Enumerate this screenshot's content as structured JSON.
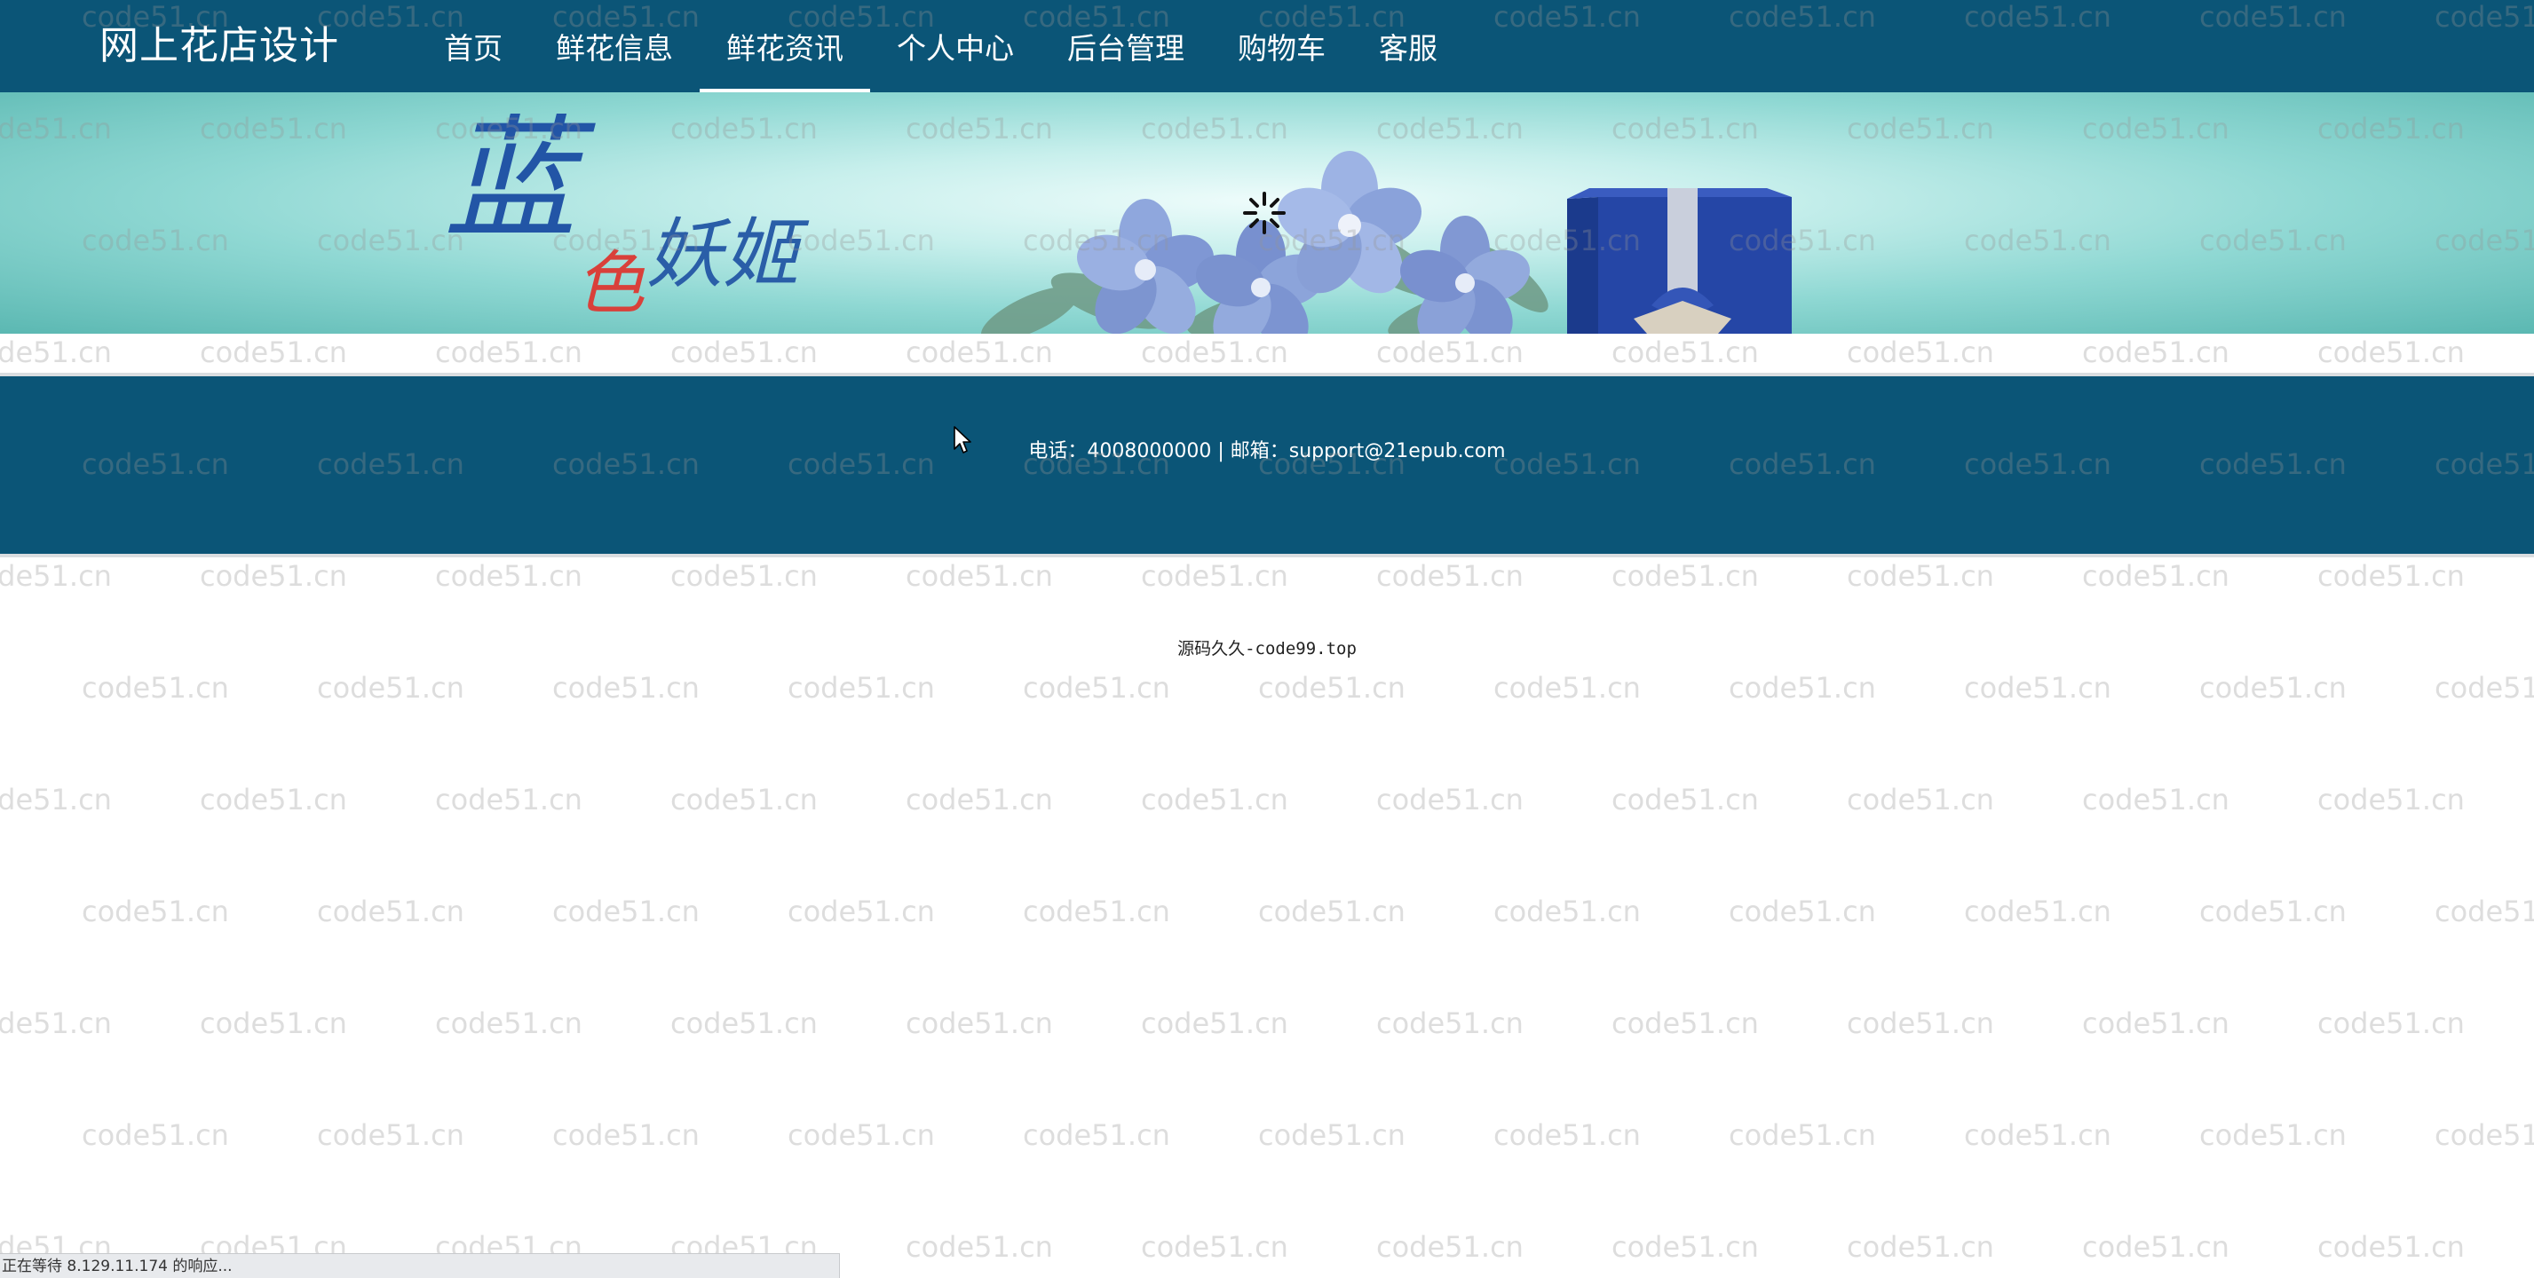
{
  "site": {
    "title": "网上花店设计"
  },
  "nav": {
    "items": [
      {
        "label": "首页",
        "active": false
      },
      {
        "label": "鲜花信息",
        "active": false
      },
      {
        "label": "鲜花资讯",
        "active": true
      },
      {
        "label": "个人中心",
        "active": false
      },
      {
        "label": "后台管理",
        "active": false
      },
      {
        "label": "购物车",
        "active": false
      },
      {
        "label": "客服",
        "active": false
      }
    ]
  },
  "banner": {
    "logo_char_1": "蓝",
    "logo_char_2": "色",
    "logo_chars_3": "妖姬"
  },
  "footer": {
    "contact": "电话：4008000000 | 邮箱：support@21epub.com"
  },
  "credit": {
    "text": "源码久久-code99.top"
  },
  "watermark": {
    "text": "code51.cn"
  },
  "statusbar": {
    "text": "正在等待 8.129.11.174 的响应..."
  },
  "colors": {
    "nav_bg": "#0b5577",
    "footer_bg": "#0b5577",
    "banner_teal": "#8fd8d3",
    "logo_blue": "#2255a6",
    "logo_red": "#d9403a"
  },
  "icons": {
    "loading": "loading-spinner-icon",
    "cursor": "mouse-pointer-icon"
  }
}
